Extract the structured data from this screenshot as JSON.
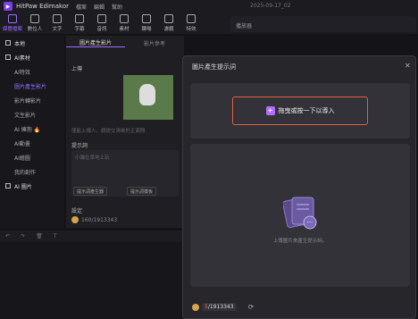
{
  "app": {
    "name": "HitPaw Edimakor",
    "date": "2025-09-17_02"
  },
  "menus": [
    "檔案",
    "編輯",
    "幫助"
  ],
  "toolbar": [
    {
      "label": "媒體檔案",
      "icon": "media-icon"
    },
    {
      "label": "數位人",
      "icon": "avatar-icon"
    },
    {
      "label": "文字",
      "icon": "text-icon"
    },
    {
      "label": "字幕",
      "icon": "subtitle-icon"
    },
    {
      "label": "音訊",
      "icon": "audio-icon"
    },
    {
      "label": "素材",
      "icon": "material-icon"
    },
    {
      "label": "轉場",
      "icon": "transition-icon"
    },
    {
      "label": "濾鏡",
      "icon": "filter-icon"
    },
    {
      "label": "特效",
      "icon": "effect-icon"
    }
  ],
  "player": {
    "title": "播放器"
  },
  "sidebar": {
    "items": [
      {
        "label": "本地",
        "type": "group"
      },
      {
        "label": "AI素材",
        "type": "group-active"
      },
      {
        "label": "AI特效",
        "type": "sub"
      },
      {
        "label": "圖片產生影片",
        "type": "sub-active"
      },
      {
        "label": "影片轉影片",
        "type": "sub"
      },
      {
        "label": "文生影片",
        "type": "sub"
      },
      {
        "label": "AI 擁抱 🔥",
        "type": "sub"
      },
      {
        "label": "AI動畫",
        "type": "sub"
      },
      {
        "label": "AI繪圖",
        "type": "sub"
      },
      {
        "label": "我的創作",
        "type": "sub"
      },
      {
        "label": "AI 圖片",
        "type": "group"
      }
    ]
  },
  "panel": {
    "tabs": [
      "圖片產生影片",
      "影片參考"
    ],
    "upload_label": "上傳",
    "upload_hint": "僅能上傳人、請提交清晰的正面照",
    "prompt_label": "提示詞",
    "prompt_placeholder": "小貓在草地上玩",
    "btn_generate_prompt": "提示詞產生器",
    "btn_template": "提示詞模板",
    "points_label": "設定",
    "points_value": "160/1913343"
  },
  "dialog": {
    "title": "圖片產生提示詞",
    "import_label": "拖曳或按一下以導入",
    "result_hint": "上傳圖片來產生提示詞。",
    "balance_used": "5",
    "balance_total": "/1913343"
  }
}
